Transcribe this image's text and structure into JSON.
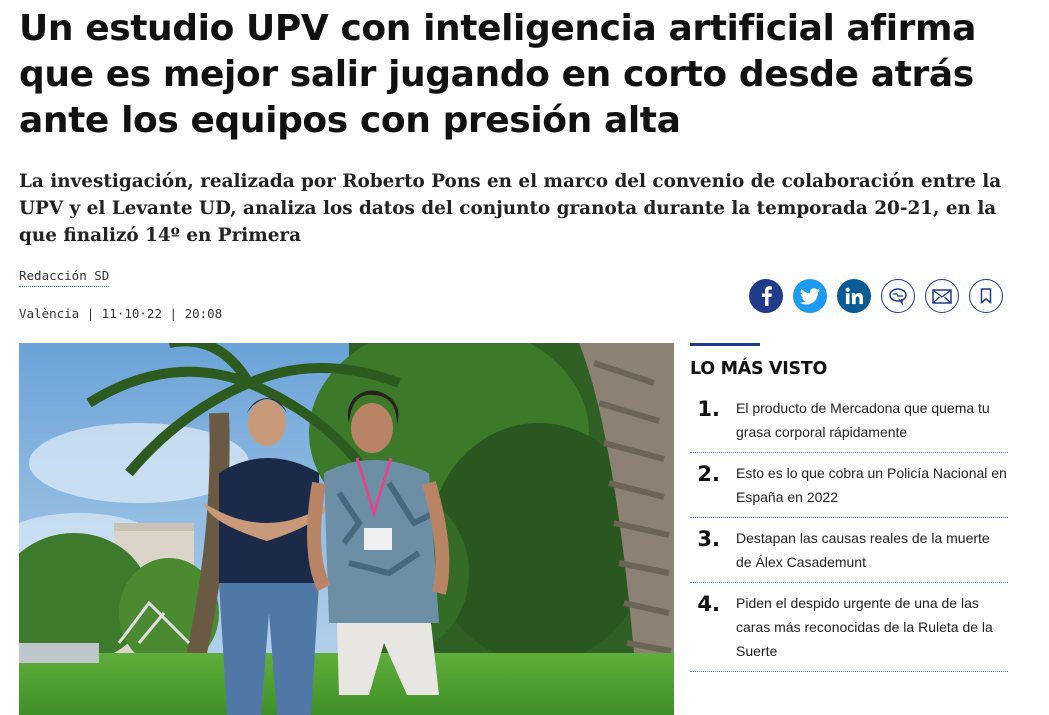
{
  "article": {
    "headline": "Un estudio UPV con inteligencia artificial afirma que es mejor salir jugando en corto desde atrás ante los equipos con presión alta",
    "subheadline": "La investigación, realizada por Roberto Pons en el marco del convenio de colaboración entre la UPV y el Levante UD, analiza los datos del conjunto granota durante la temporada 20-21, en la que finalizó 14º en Primera",
    "author": "Redacción SD",
    "dateline": "València | 11·10·22 | 20:08"
  },
  "share": {
    "icons": [
      "facebook-icon",
      "twitter-icon",
      "linkedin-icon",
      "comment-icon",
      "email-icon",
      "bookmark-icon"
    ],
    "colors": {
      "facebook": "#1f3b8a",
      "twitter": "#1d9bf0",
      "linkedin": "#0a5a94",
      "outline": "#1f3b8a"
    }
  },
  "most_viewed": {
    "title": "LO MÁS VISTO",
    "items": [
      {
        "num": "1.",
        "text": "El producto de Mercadona que quema tu grasa corporal rápidamente"
      },
      {
        "num": "2.",
        "text": "Esto es lo que cobra un Policía Nacional en España en 2022"
      },
      {
        "num": "3.",
        "text": "Destapan las causas reales de la muerte de Álex Casademunt"
      },
      {
        "num": "4.",
        "text": "Piden el despido urgente de una de las caras más reconocidas de la Ruleta de la Suerte"
      }
    ]
  }
}
